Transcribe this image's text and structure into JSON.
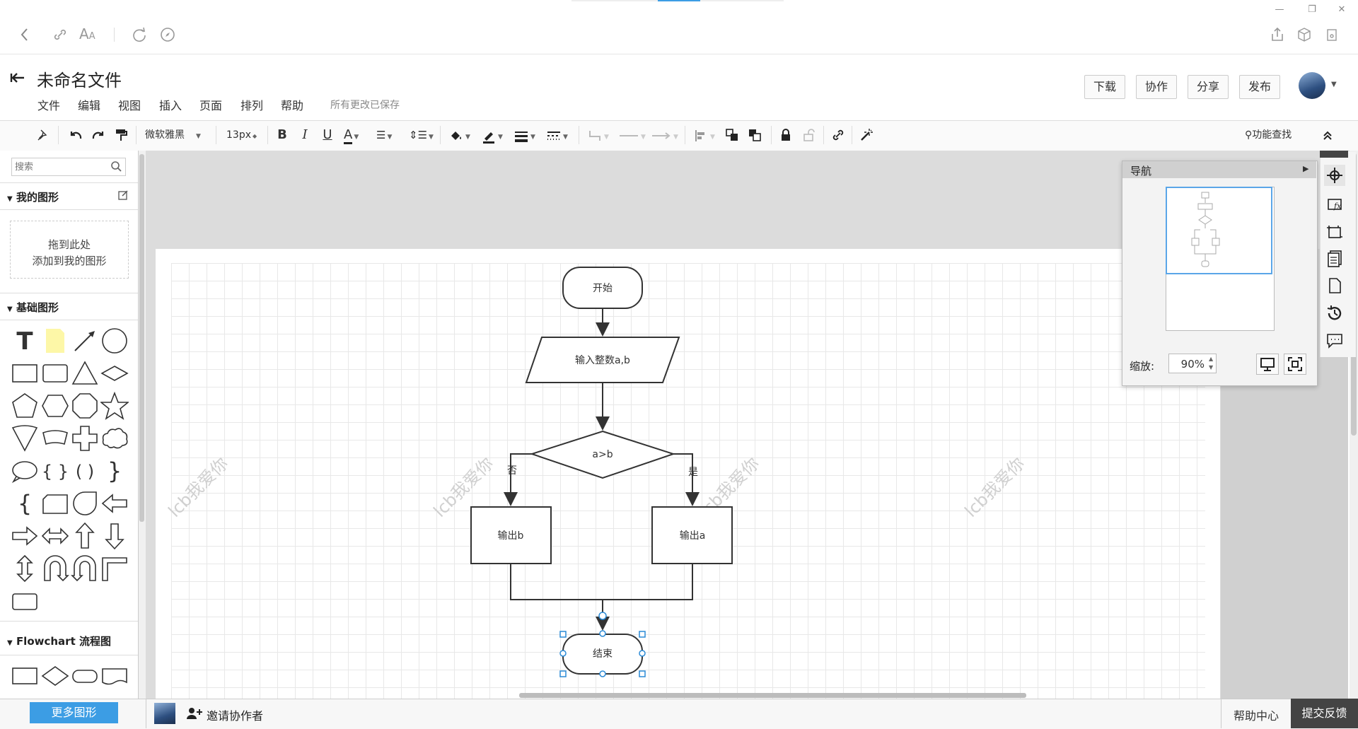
{
  "browser": {
    "window_controls": [
      "—",
      "❐",
      "✕"
    ]
  },
  "header": {
    "title": "未命名文件",
    "menu": [
      "文件",
      "编辑",
      "视图",
      "插入",
      "页面",
      "排列",
      "帮助"
    ],
    "save_status": "所有更改已保存",
    "buttons": {
      "download": "下载",
      "collab": "协作",
      "share": "分享",
      "publish": "发布"
    }
  },
  "toolbar": {
    "font": "微软雅黑",
    "font_size": "13px",
    "search": "功能查找"
  },
  "left_panel": {
    "search_placeholder": "搜索",
    "my_shapes": {
      "title": "我的图形",
      "drop_line1": "拖到此处",
      "drop_line2": "添加到我的图形"
    },
    "basic_shapes": {
      "title": "基础图形"
    },
    "flowchart": {
      "title": "Flowchart 流程图"
    },
    "more_button": "更多图形"
  },
  "flowchart": {
    "start": "开始",
    "input": "输入整数a,b",
    "decision": "a>b",
    "no_label": "否",
    "yes_label": "是",
    "out_b": "输出b",
    "out_a": "输出a",
    "end": "结束"
  },
  "watermark": "lcb我爱你",
  "nav_panel": {
    "title": "导航",
    "zoom_label": "缩放:",
    "zoom_value": "90%"
  },
  "bottom": {
    "invite": "邀请协作者",
    "help": "帮助中心",
    "feedback": "提交反馈"
  },
  "colors": {
    "accent": "#3c9de4",
    "selection": "#2a8ad6",
    "feedback_bg": "#444444"
  }
}
